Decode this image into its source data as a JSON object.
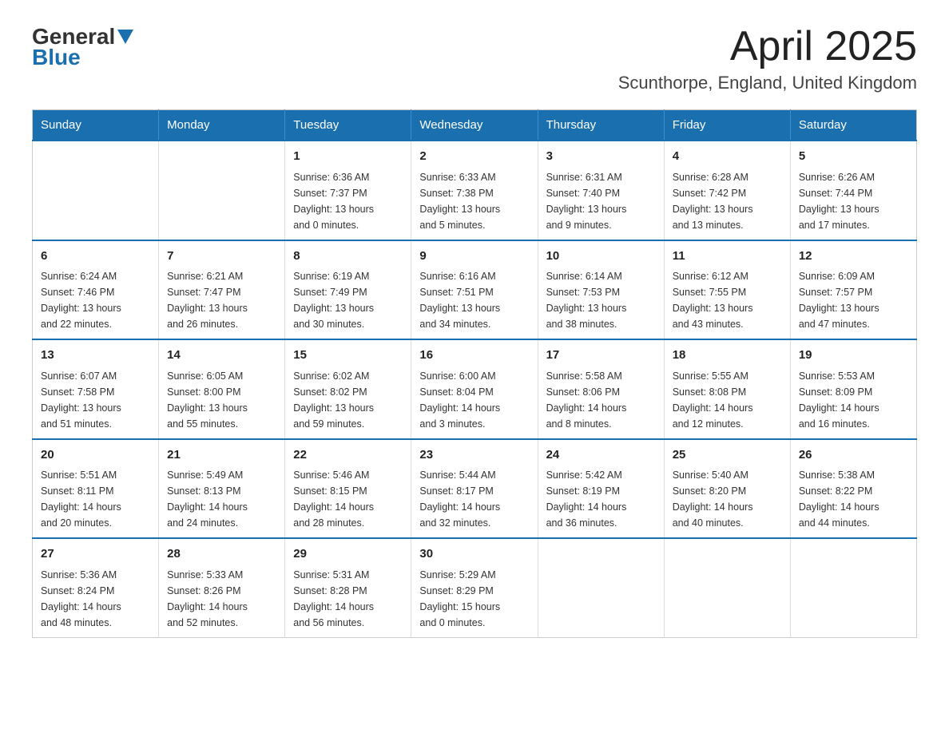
{
  "logo": {
    "text_general": "General",
    "text_blue": "Blue"
  },
  "title": "April 2025",
  "subtitle": "Scunthorpe, England, United Kingdom",
  "weekdays": [
    "Sunday",
    "Monday",
    "Tuesday",
    "Wednesday",
    "Thursday",
    "Friday",
    "Saturday"
  ],
  "weeks": [
    [
      {
        "day": "",
        "info": ""
      },
      {
        "day": "",
        "info": ""
      },
      {
        "day": "1",
        "info": "Sunrise: 6:36 AM\nSunset: 7:37 PM\nDaylight: 13 hours\nand 0 minutes."
      },
      {
        "day": "2",
        "info": "Sunrise: 6:33 AM\nSunset: 7:38 PM\nDaylight: 13 hours\nand 5 minutes."
      },
      {
        "day": "3",
        "info": "Sunrise: 6:31 AM\nSunset: 7:40 PM\nDaylight: 13 hours\nand 9 minutes."
      },
      {
        "day": "4",
        "info": "Sunrise: 6:28 AM\nSunset: 7:42 PM\nDaylight: 13 hours\nand 13 minutes."
      },
      {
        "day": "5",
        "info": "Sunrise: 6:26 AM\nSunset: 7:44 PM\nDaylight: 13 hours\nand 17 minutes."
      }
    ],
    [
      {
        "day": "6",
        "info": "Sunrise: 6:24 AM\nSunset: 7:46 PM\nDaylight: 13 hours\nand 22 minutes."
      },
      {
        "day": "7",
        "info": "Sunrise: 6:21 AM\nSunset: 7:47 PM\nDaylight: 13 hours\nand 26 minutes."
      },
      {
        "day": "8",
        "info": "Sunrise: 6:19 AM\nSunset: 7:49 PM\nDaylight: 13 hours\nand 30 minutes."
      },
      {
        "day": "9",
        "info": "Sunrise: 6:16 AM\nSunset: 7:51 PM\nDaylight: 13 hours\nand 34 minutes."
      },
      {
        "day": "10",
        "info": "Sunrise: 6:14 AM\nSunset: 7:53 PM\nDaylight: 13 hours\nand 38 minutes."
      },
      {
        "day": "11",
        "info": "Sunrise: 6:12 AM\nSunset: 7:55 PM\nDaylight: 13 hours\nand 43 minutes."
      },
      {
        "day": "12",
        "info": "Sunrise: 6:09 AM\nSunset: 7:57 PM\nDaylight: 13 hours\nand 47 minutes."
      }
    ],
    [
      {
        "day": "13",
        "info": "Sunrise: 6:07 AM\nSunset: 7:58 PM\nDaylight: 13 hours\nand 51 minutes."
      },
      {
        "day": "14",
        "info": "Sunrise: 6:05 AM\nSunset: 8:00 PM\nDaylight: 13 hours\nand 55 minutes."
      },
      {
        "day": "15",
        "info": "Sunrise: 6:02 AM\nSunset: 8:02 PM\nDaylight: 13 hours\nand 59 minutes."
      },
      {
        "day": "16",
        "info": "Sunrise: 6:00 AM\nSunset: 8:04 PM\nDaylight: 14 hours\nand 3 minutes."
      },
      {
        "day": "17",
        "info": "Sunrise: 5:58 AM\nSunset: 8:06 PM\nDaylight: 14 hours\nand 8 minutes."
      },
      {
        "day": "18",
        "info": "Sunrise: 5:55 AM\nSunset: 8:08 PM\nDaylight: 14 hours\nand 12 minutes."
      },
      {
        "day": "19",
        "info": "Sunrise: 5:53 AM\nSunset: 8:09 PM\nDaylight: 14 hours\nand 16 minutes."
      }
    ],
    [
      {
        "day": "20",
        "info": "Sunrise: 5:51 AM\nSunset: 8:11 PM\nDaylight: 14 hours\nand 20 minutes."
      },
      {
        "day": "21",
        "info": "Sunrise: 5:49 AM\nSunset: 8:13 PM\nDaylight: 14 hours\nand 24 minutes."
      },
      {
        "day": "22",
        "info": "Sunrise: 5:46 AM\nSunset: 8:15 PM\nDaylight: 14 hours\nand 28 minutes."
      },
      {
        "day": "23",
        "info": "Sunrise: 5:44 AM\nSunset: 8:17 PM\nDaylight: 14 hours\nand 32 minutes."
      },
      {
        "day": "24",
        "info": "Sunrise: 5:42 AM\nSunset: 8:19 PM\nDaylight: 14 hours\nand 36 minutes."
      },
      {
        "day": "25",
        "info": "Sunrise: 5:40 AM\nSunset: 8:20 PM\nDaylight: 14 hours\nand 40 minutes."
      },
      {
        "day": "26",
        "info": "Sunrise: 5:38 AM\nSunset: 8:22 PM\nDaylight: 14 hours\nand 44 minutes."
      }
    ],
    [
      {
        "day": "27",
        "info": "Sunrise: 5:36 AM\nSunset: 8:24 PM\nDaylight: 14 hours\nand 48 minutes."
      },
      {
        "day": "28",
        "info": "Sunrise: 5:33 AM\nSunset: 8:26 PM\nDaylight: 14 hours\nand 52 minutes."
      },
      {
        "day": "29",
        "info": "Sunrise: 5:31 AM\nSunset: 8:28 PM\nDaylight: 14 hours\nand 56 minutes."
      },
      {
        "day": "30",
        "info": "Sunrise: 5:29 AM\nSunset: 8:29 PM\nDaylight: 15 hours\nand 0 minutes."
      },
      {
        "day": "",
        "info": ""
      },
      {
        "day": "",
        "info": ""
      },
      {
        "day": "",
        "info": ""
      }
    ]
  ]
}
